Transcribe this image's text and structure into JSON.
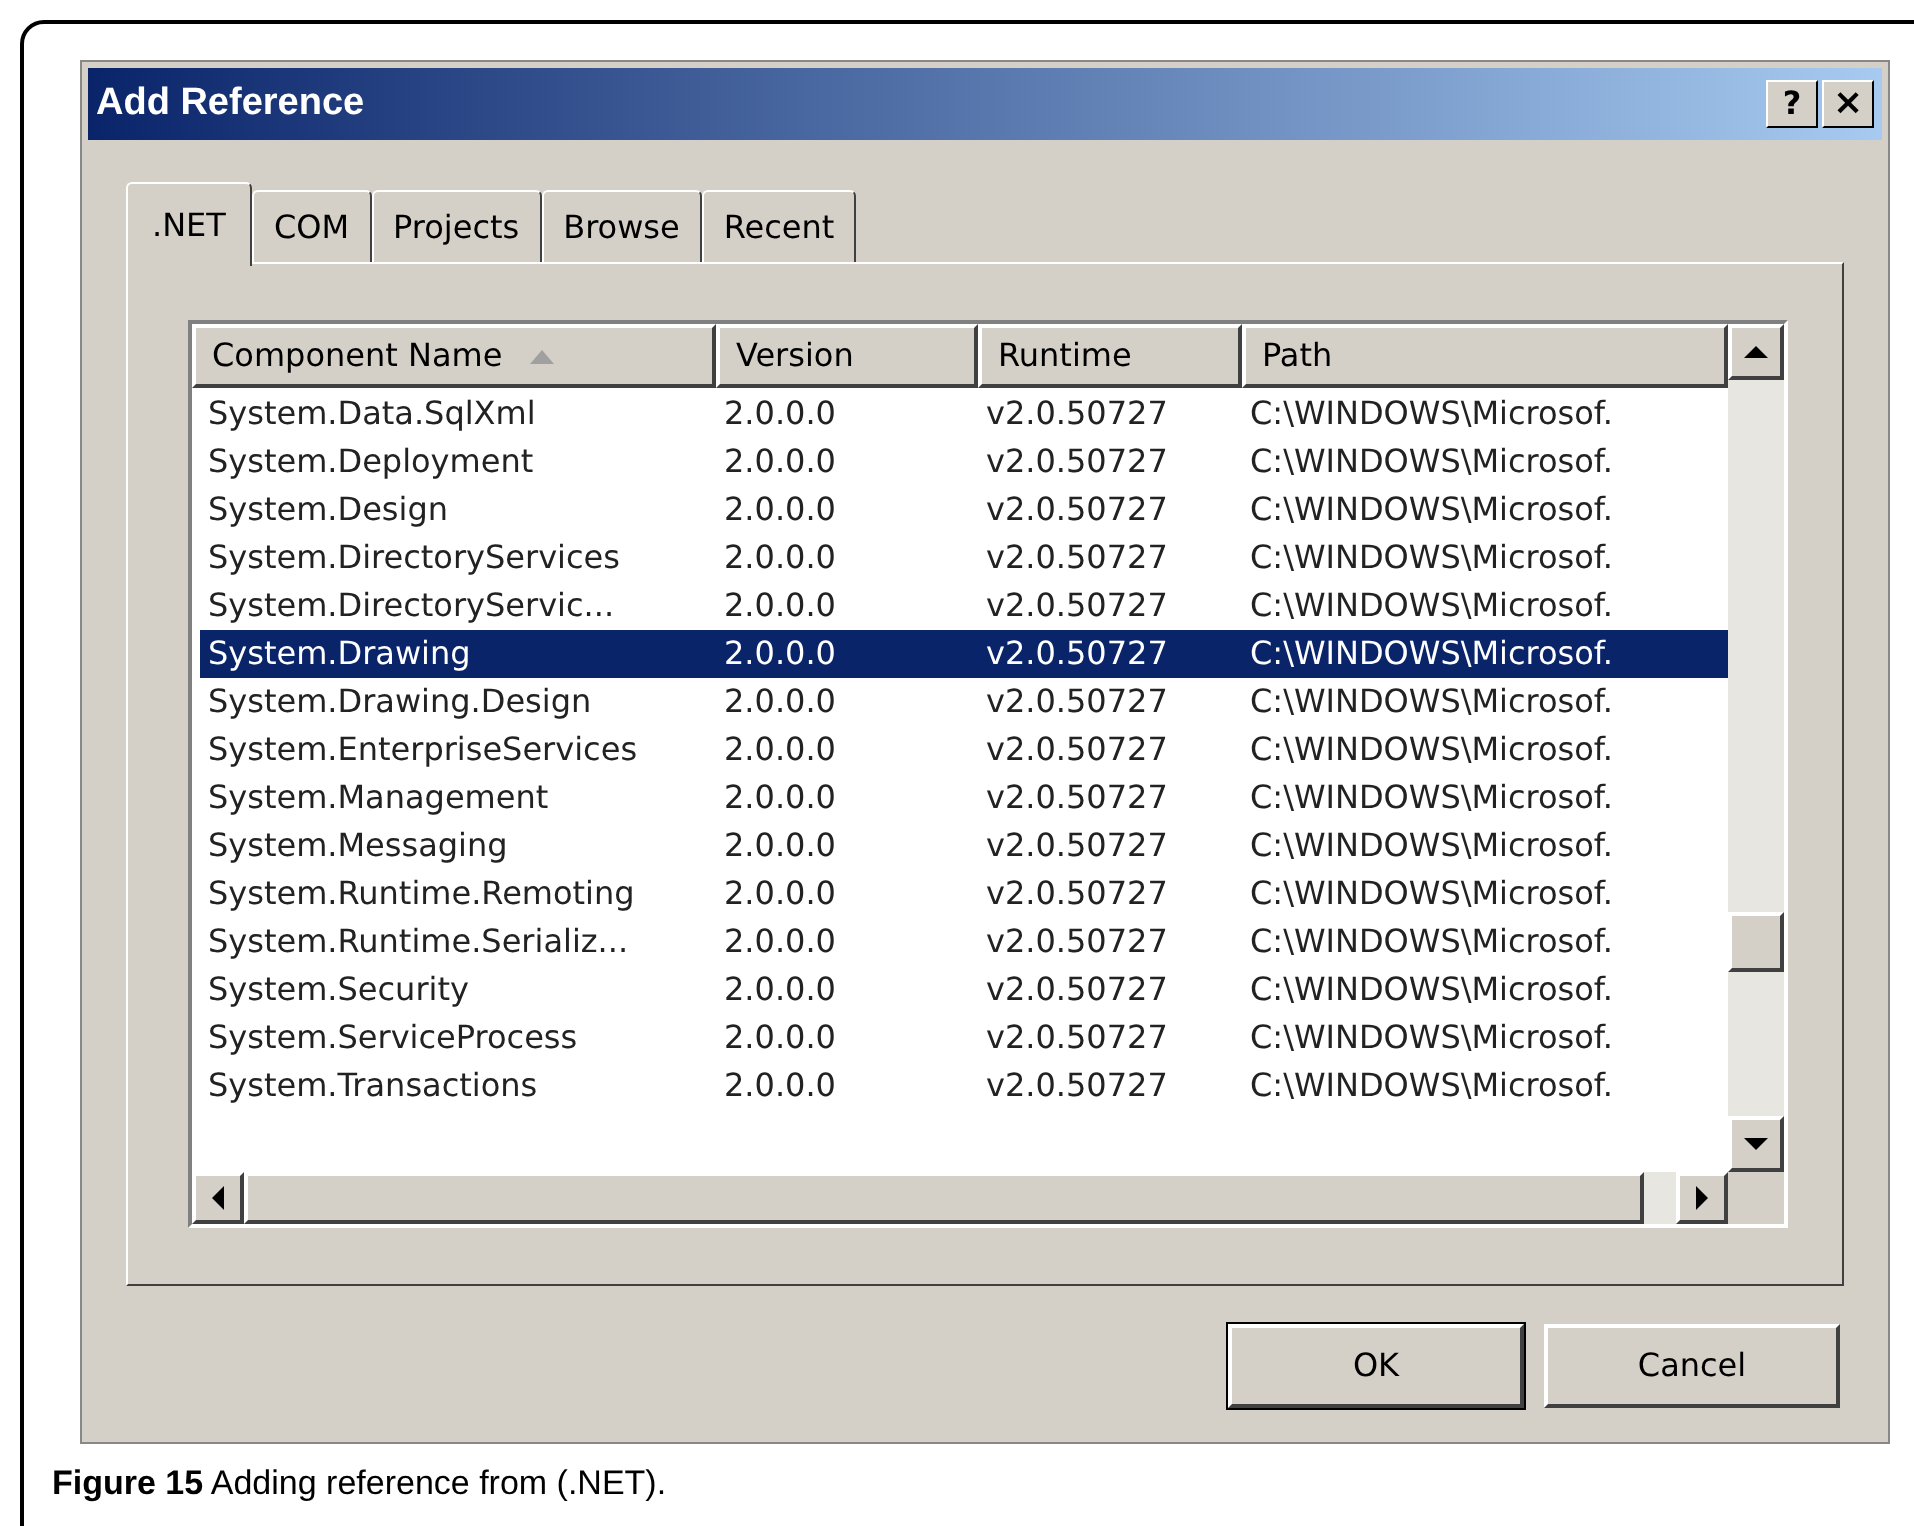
{
  "window": {
    "title": "Add Reference",
    "help_button": "?",
    "close_button": "×"
  },
  "tabs": [
    {
      "label": ".NET",
      "selected": true
    },
    {
      "label": "COM",
      "selected": false
    },
    {
      "label": "Projects",
      "selected": false
    },
    {
      "label": "Browse",
      "selected": false
    },
    {
      "label": "Recent",
      "selected": false
    }
  ],
  "table": {
    "columns": [
      "Component Name",
      "Version",
      "Runtime",
      "Path"
    ],
    "rows": [
      {
        "cells": [
          "System.Data.SqlXml",
          "2.0.0.0",
          "v2.0.50727",
          "C:\\WINDOWS\\Microsof."
        ],
        "selected": false
      },
      {
        "cells": [
          "System.Deployment",
          "2.0.0.0",
          "v2.0.50727",
          "C:\\WINDOWS\\Microsof."
        ],
        "selected": false
      },
      {
        "cells": [
          "System.Design",
          "2.0.0.0",
          "v2.0.50727",
          "C:\\WINDOWS\\Microsof."
        ],
        "selected": false
      },
      {
        "cells": [
          "System.DirectoryServices",
          "2.0.0.0",
          "v2.0.50727",
          "C:\\WINDOWS\\Microsof."
        ],
        "selected": false
      },
      {
        "cells": [
          "System.DirectoryServic...",
          "2.0.0.0",
          "v2.0.50727",
          "C:\\WINDOWS\\Microsof."
        ],
        "selected": false
      },
      {
        "cells": [
          "System.Drawing",
          "2.0.0.0",
          "v2.0.50727",
          "C:\\WINDOWS\\Microsof."
        ],
        "selected": true
      },
      {
        "cells": [
          "System.Drawing.Design",
          "2.0.0.0",
          "v2.0.50727",
          "C:\\WINDOWS\\Microsof."
        ],
        "selected": false
      },
      {
        "cells": [
          "System.EnterpriseServices",
          "2.0.0.0",
          "v2.0.50727",
          "C:\\WINDOWS\\Microsof."
        ],
        "selected": false
      },
      {
        "cells": [
          "System.Management",
          "2.0.0.0",
          "v2.0.50727",
          "C:\\WINDOWS\\Microsof."
        ],
        "selected": false
      },
      {
        "cells": [
          "System.Messaging",
          "2.0.0.0",
          "v2.0.50727",
          "C:\\WINDOWS\\Microsof."
        ],
        "selected": false
      },
      {
        "cells": [
          "System.Runtime.Remoting",
          "2.0.0.0",
          "v2.0.50727",
          "C:\\WINDOWS\\Microsof."
        ],
        "selected": false
      },
      {
        "cells": [
          "System.Runtime.Serializ...",
          "2.0.0.0",
          "v2.0.50727",
          "C:\\WINDOWS\\Microsof."
        ],
        "selected": false
      },
      {
        "cells": [
          "System.Security",
          "2.0.0.0",
          "v2.0.50727",
          "C:\\WINDOWS\\Microsof."
        ],
        "selected": false
      },
      {
        "cells": [
          "System.ServiceProcess",
          "2.0.0.0",
          "v2.0.50727",
          "C:\\WINDOWS\\Microsof."
        ],
        "selected": false
      },
      {
        "cells": [
          "System.Transactions",
          "2.0.0.0",
          "v2.0.50727",
          "C:\\WINDOWS\\Microsof."
        ],
        "selected": false
      }
    ]
  },
  "buttons": [
    "OK",
    "Cancel"
  ],
  "caption": "**Figure 15** Adding reference from (.NET)."
}
